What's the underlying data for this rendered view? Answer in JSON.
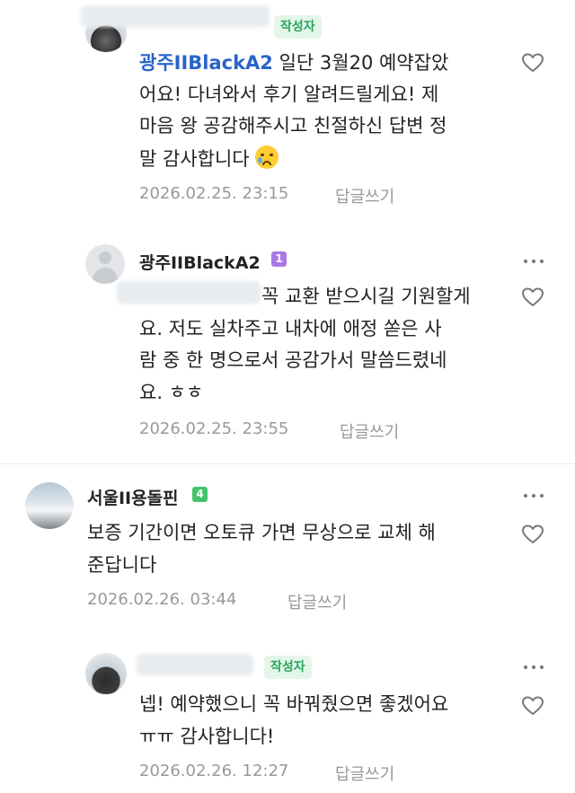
{
  "comments": [
    {
      "author_badge": "작성자",
      "mention": "광주IIBlackA2",
      "lines": [
        " 일단 3월20 예약잡았",
        "어요! 다녀와서 후기 알려드릴게요! 제",
        "마음 왕 공감해주시고 친절하신 답변 정",
        "말 감사합니다"
      ],
      "emoji": "😢",
      "date": "2026.02.25. 23:15",
      "reply": "답글쓰기"
    },
    {
      "author": "광주IIBlackA2",
      "grade": "1",
      "lines": [
        "꼭 교환 받으시길 기원할게",
        "요. 저도 실차주고 내차에 애정 쏟은 사",
        "람 중 한 명으로서 공감가서 말씀드렸네",
        "요. ㅎㅎ"
      ],
      "date": "2026.02.25. 23:55",
      "reply": "답글쓰기"
    },
    {
      "author": "서울II용돌핀",
      "grade": "4",
      "lines": [
        "보증 기간이면 오토큐 가면 무상으로 교체 해",
        "준답니다"
      ],
      "date": "2026.02.26. 03:44",
      "reply": "답글쓰기"
    },
    {
      "author_badge": "작성자",
      "lines": [
        "넵! 예약했으니 꼭 바꿔줬으면 좋겠어요",
        "ㅠㅠ 감사합니다!"
      ],
      "date": "2026.02.26. 12:27",
      "reply": "답글쓰기"
    }
  ],
  "colors": {
    "badge_green": "#26a65b",
    "mention_blue": "#2a64c9",
    "grade_purple": "#a979e6",
    "grade_green": "#45c36b",
    "meta_gray": "#999999"
  },
  "icons": [
    "kebab-menu-icon",
    "heart-outline-icon",
    "crying-face-emoji"
  ]
}
